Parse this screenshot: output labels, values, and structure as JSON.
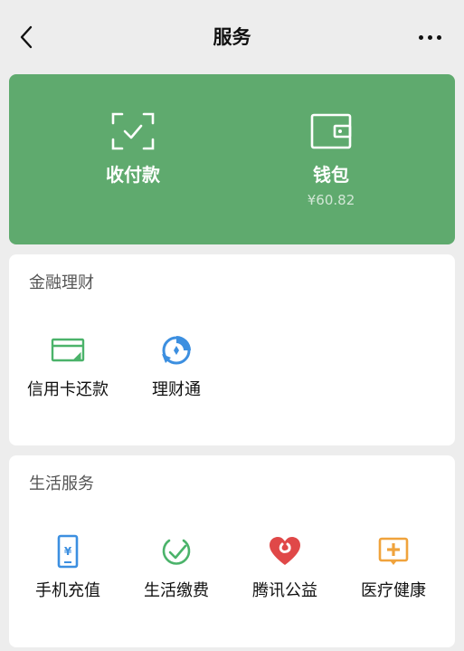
{
  "header": {
    "title": "服务"
  },
  "wallet_panel": {
    "pay": {
      "label": "收付款",
      "icon": "scan-check-icon"
    },
    "wallet": {
      "label": "钱包",
      "balance": "¥60.82",
      "icon": "wallet-icon"
    },
    "background_color": "#5faa6e"
  },
  "finance": {
    "title": "金融理财",
    "items": [
      {
        "label": "信用卡还款",
        "icon": "credit-card-icon",
        "color": "#4bb36a"
      },
      {
        "label": "理财通",
        "icon": "licaitong-icon",
        "color": "#3c8fe0"
      }
    ]
  },
  "life": {
    "title": "生活服务",
    "items": [
      {
        "label": "手机充值",
        "icon": "phone-icon",
        "color": "#3c8fe0"
      },
      {
        "label": "生活缴费",
        "icon": "check-circle-icon",
        "color": "#4bb36a"
      },
      {
        "label": "腾讯公益",
        "icon": "heart-icon",
        "color": "#e04848"
      },
      {
        "label": "医疗健康",
        "icon": "medical-icon",
        "color": "#f0a33c"
      }
    ]
  }
}
